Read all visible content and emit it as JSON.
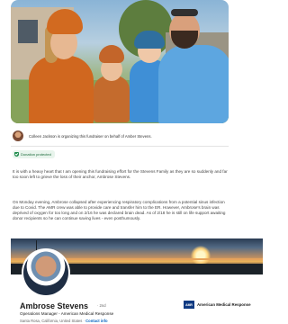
{
  "hero": {
    "alt": "Family photo in costumes"
  },
  "organizer": {
    "text": "Colleen Jackson is organizing this fundraiser on behalf of Amber Stevens."
  },
  "badge": {
    "label": "Donation protected"
  },
  "story": {
    "paragraph1": "It is with a heavy heart that I am opening this fundraising effort for the Stevens Family as they are so suddenly and far too soon left to grieve the loss of their anchor, Ambrose Stevens.",
    "paragraph2": "On Monday evening, Ambrose collapsed after experiencing respiratory complications from a potential sinus infection due to Covid. The AMR crew was able to provide care and transfer him to the ER. However, Ambrose's brain was deprived of oxygen for too long and on 2/16 he was declared brain dead. As of 2/18 he is still on life support awaiting donor recipients so he can continue saving lives - even posthumously."
  },
  "linkedin": {
    "name": "Ambrose Stevens",
    "pronoun": "· 2nd",
    "title": "Operations Manager - American Medical Response",
    "location": "Santa Rosa, California, United States",
    "contact_label": "Contact info",
    "company": {
      "logo_text": "AMR",
      "name": "American Medical Response"
    }
  },
  "icons": [
    "shield-check-icon",
    "company-logo-icon"
  ],
  "colors": {
    "accent_green": "#1c8a4a",
    "linkedin_blue": "#0a66c2",
    "amr_blue": "#0f3a82"
  }
}
